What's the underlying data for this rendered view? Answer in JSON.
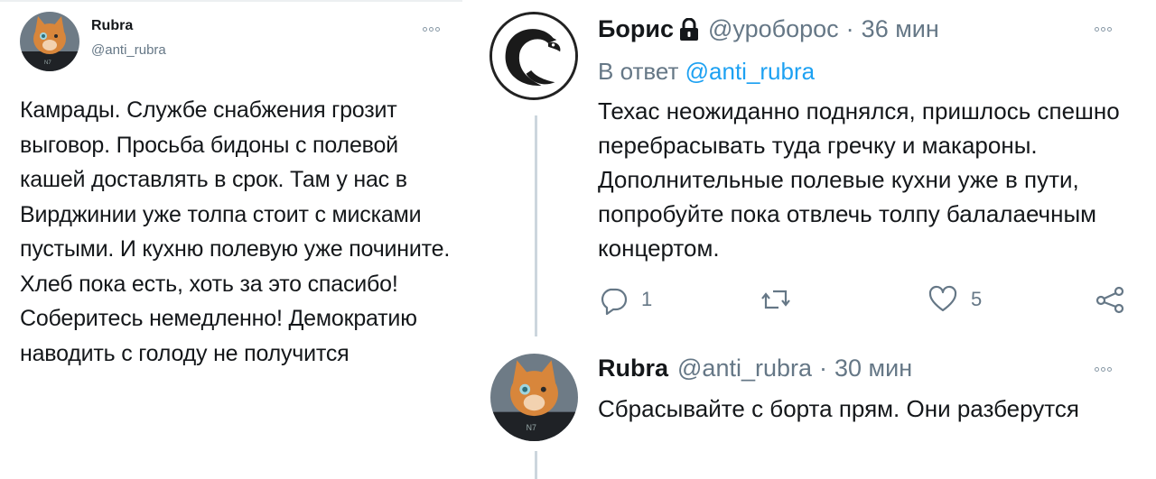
{
  "tweet": {
    "author": "Rubra",
    "handle": "@anti_rubra",
    "text": "Камрады. Службе снабжения грозит выговор. Просьба бидоны с полевой кашей доставлять в срок. Там у нас в Вирджинии уже толпа стоит с мисками пустыми. И кухню полевую уже почините. Хлеб пока есть, хоть за это спасибо! Соберитесь немедленно! Демократию наводить с голоду не получится"
  },
  "reply1": {
    "author": "Борис",
    "handle": "@уроборос",
    "separator": "·",
    "time": "36 мин",
    "reply_prefix": "В ответ",
    "reply_handle": "@anti_rubra",
    "text": "Техас неожиданно поднялся, пришлось спешно перебрасывать туда гречку и макароны. Дополнительные полевые кухни уже в пути, попробуйте пока отвлечь толпу балалаечным концертом.",
    "actions": {
      "reply_count": "1",
      "retweet_count": "",
      "like_count": "5"
    }
  },
  "reply2": {
    "author": "Rubra",
    "handle": "@anti_rubra",
    "separator": "·",
    "time": "30 мин",
    "text": "Сбрасывайте с борта прям. Они разберутся"
  },
  "icons": {
    "more": "more-options-icon",
    "lock": "lock-icon",
    "reply": "reply-icon",
    "retweet": "retweet-icon",
    "like": "heart-icon",
    "share": "share-icon"
  },
  "colors": {
    "text": "#14171a",
    "muted": "#657786",
    "link": "#1da1f2",
    "icon": "#657786"
  }
}
